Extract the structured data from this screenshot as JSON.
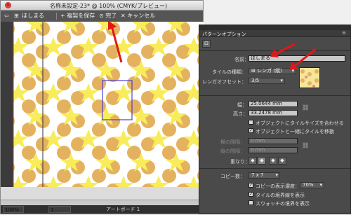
{
  "window": {
    "title": "名称未設定-23* @ 100% (CMYK/プレビュー)",
    "close_glyph": "×"
  },
  "toolbar": {
    "back_glyph": "⇦",
    "pattern_glyph": "⊞",
    "pattern_name": "ほしまる",
    "save_copy_label": "+ 複製を保存",
    "done_label": "完了",
    "cancel_label": "キャンセル"
  },
  "status": {
    "zoom": "100%",
    "page": "1",
    "artboard": "アートボード 1"
  },
  "panel": {
    "title": "パターンオプション",
    "menu_glyph": "≡",
    "name_label": "名前：",
    "name_value": "ほしまる",
    "tile_type_label": "タイルの種類：",
    "tile_type_value": "レンガ (縦)",
    "brick_offset_label": "レンガオフセット：",
    "brick_offset_value": "3/5",
    "width_label": "幅：",
    "width_value": "25.0644 mm",
    "height_label": "高さ：",
    "height_value": "33.2478 mm",
    "fit_tile_label": "オブジェクトにタイルサイズを合わせる",
    "move_tile_label": "オブジェクトと一緒にタイルを移動",
    "h_spacing_label": "横の間隔：",
    "h_spacing_value": "0 mm",
    "v_spacing_label": "縦の間隔：",
    "v_spacing_value": "0 mm",
    "overlap_label": "重なり：",
    "copies_label": "コピー数：",
    "copies_value": "7 x 7",
    "dim_copies_label": "コピーの表示濃度：",
    "dim_copies_value": "70%",
    "show_tile_edge_label": "タイルの境界線を表示",
    "show_swatch_bounds_label": "スウォッチの境界を表示",
    "checked_glyph": "✓",
    "dropdown_glyph": "▾"
  },
  "colors": {
    "star": "#f8ec5a",
    "circle": "#e4b25e",
    "selection": "#4b3fd0",
    "arrow": "#e01818",
    "guide": "#d03030"
  }
}
